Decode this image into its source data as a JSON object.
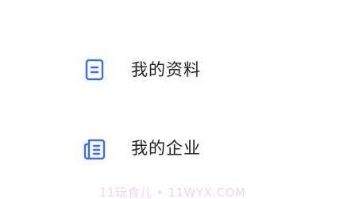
{
  "menu": {
    "items": [
      {
        "label": "我的资料",
        "icon": "document-icon",
        "color": "#3b6cf2"
      },
      {
        "label": "我的企业",
        "icon": "company-document-icon",
        "color": "#3b6cf2"
      }
    ]
  },
  "watermark": {
    "text": "11玩食儿 • 11WYX.COM",
    "color": "#f1bff3"
  }
}
